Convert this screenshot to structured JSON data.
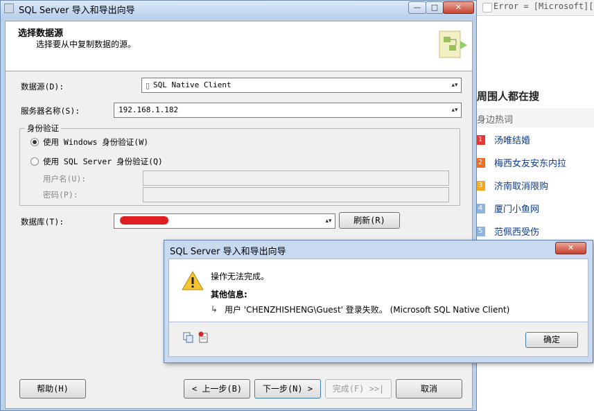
{
  "background_page": {
    "tab_title": "Error = [Microsoft][SQL",
    "heading": "周围人都在搜",
    "subheading": "身边热词",
    "hot_items": [
      {
        "rank": "1",
        "text": "汤唯结婚",
        "color": "#e53935"
      },
      {
        "rank": "2",
        "text": "梅西女友安东内拉",
        "color": "#f36c21"
      },
      {
        "rank": "3",
        "text": "济南取消限购",
        "color": "#f5a623"
      },
      {
        "rank": "4",
        "text": "厦门小鱼网",
        "color": "#8fb3e0"
      },
      {
        "rank": "5",
        "text": "范佩西受伤",
        "color": "#8fb3e0"
      }
    ]
  },
  "wizard": {
    "title": "SQL Server 导入和导出向导",
    "caption_buttons": {
      "minimize": "—",
      "maximize": "□",
      "close": "✕"
    },
    "page_title": "选择数据源",
    "page_description": "选择要从中复制数据的源。",
    "data_source_label": "数据源(D):",
    "data_source_value": "SQL Native Client",
    "server_name_label": "服务器名称(S):",
    "server_name_value": "192.168.1.182",
    "auth_group_label": "身份验证",
    "auth_windows_label": "使用 Windows 身份验证(W)",
    "auth_sql_label": "使用 SQL Server 身份验证(Q)",
    "username_label": "用户名(U):",
    "password_label": "密码(P):",
    "database_label": "数据库(T):",
    "refresh_button": "刷新(R)",
    "help_button": "帮助(H)",
    "back_button": "< 上一步(B)",
    "next_button": "下一步(N) >",
    "finish_button": "完成(F) >>|",
    "cancel_button": "取消"
  },
  "error_dialog": {
    "title": "SQL Server 导入和导出向导",
    "close_glyph": "✕",
    "message": "操作无法完成。",
    "more_info_heading": "其他信息:",
    "detail_arrow": "↳",
    "detail": "用户 'CHENZHISHENG\\Guest' 登录失败。 (Microsoft SQL Native Client)",
    "ok_button": "确定",
    "warning_icon": "warning-triangle-icon",
    "copy_icon": "copy-icon",
    "details_icon": "details-icon"
  }
}
